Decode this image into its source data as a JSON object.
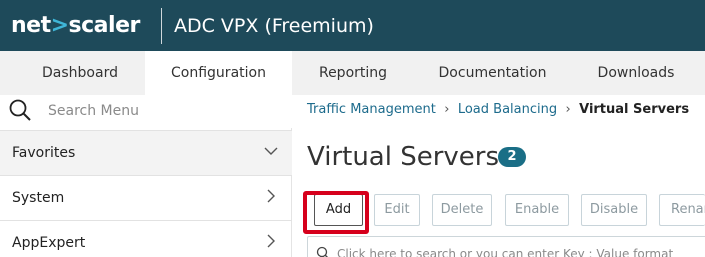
{
  "header": {
    "logo_left": "net",
    "logo_chevron": ">",
    "logo_right": "scaler",
    "product_title": "ADC VPX (Freemium)"
  },
  "nav": {
    "tabs": [
      {
        "label": "Dashboard",
        "active": false
      },
      {
        "label": "Configuration",
        "active": true
      },
      {
        "label": "Reporting",
        "active": false
      },
      {
        "label": "Documentation",
        "active": false
      },
      {
        "label": "Downloads",
        "active": false
      }
    ]
  },
  "sidebar": {
    "search_placeholder": "Search Menu",
    "items": [
      {
        "label": "Favorites",
        "chevron": "down"
      },
      {
        "label": "System",
        "chevron": "right"
      },
      {
        "label": "AppExpert",
        "chevron": "right"
      }
    ]
  },
  "breadcrumb": {
    "items": [
      "Traffic Management",
      "Load Balancing",
      "Virtual Servers"
    ]
  },
  "main": {
    "title": "Virtual Servers",
    "count": "2",
    "buttons": [
      "Add",
      "Edit",
      "Delete",
      "Enable",
      "Disable",
      "Renar"
    ],
    "search_placeholder": "Click here to search or you can enter Key : Value format"
  },
  "colors": {
    "header_bg": "#1e4a5a",
    "accent": "#1a6e86",
    "highlight": "#d6001c"
  }
}
